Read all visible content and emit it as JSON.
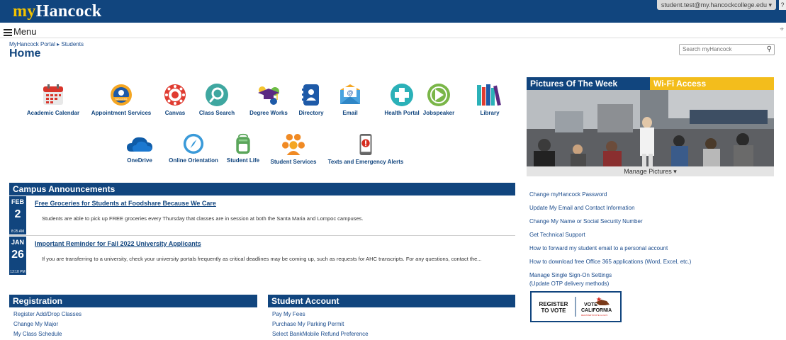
{
  "header": {
    "logo_my": "my",
    "logo_rest": "Hancock",
    "user": "student.test@my.hancockcollege.edu ▾",
    "edge": "?"
  },
  "menu": {
    "label": "Menu"
  },
  "breadcrumb": "MyHancock Portal ▸ Students",
  "page_title": "Home",
  "search": {
    "placeholder": "Search myHancock"
  },
  "apps_row1": [
    {
      "label": "Academic Calendar",
      "icon": "calendar-icon"
    },
    {
      "label": "Appointment Services",
      "icon": "appointment-icon"
    },
    {
      "label": "Canvas",
      "icon": "canvas-icon"
    },
    {
      "label": "Class Search",
      "icon": "search-icon"
    },
    {
      "label": "Degree Works",
      "icon": "graduation-cap-icon"
    },
    {
      "label": "Directory",
      "icon": "directory-icon"
    },
    {
      "label": "Email",
      "icon": "email-icon"
    },
    {
      "label": "Health Portal",
      "icon": "health-icon"
    },
    {
      "label": "Jobspeaker",
      "icon": "jobspeaker-icon"
    },
    {
      "label": "Library",
      "icon": "library-icon"
    }
  ],
  "apps_row2": [
    {
      "label": "OneDrive",
      "icon": "cloud-icon"
    },
    {
      "label": "Online Orientation",
      "icon": "compass-icon"
    },
    {
      "label": "Student Life",
      "icon": "backpack-icon"
    },
    {
      "label": "Student Services",
      "icon": "people-icon"
    },
    {
      "label": "Texts and Emergency Alerts",
      "icon": "alert-phone-icon"
    }
  ],
  "gallery": {
    "tab1": "Pictures Of The Week",
    "tab2": "Wi-Fi Access",
    "manage": "Manage Pictures ▾"
  },
  "quick_links": [
    "Change myHancock Password",
    "Update My Email and Contact Information",
    "Change My Name or Social Security Number",
    "Get Technical Support",
    "How to forward my student email to a personal account",
    "How to download free Office 365 applications (Word, Excel, etc.)"
  ],
  "sso": {
    "line1": "Manage Single Sign-On Settings",
    "line2": "(Update OTP delivery methods)"
  },
  "announcements": {
    "title": "Campus Announcements",
    "items": [
      {
        "month": "FEB",
        "day": "2",
        "time": "8:25 AM",
        "title": "Free Groceries for Students at Foodshare Because We Care",
        "body": "Students are able to pick up FREE groceries every Thursday that classes are in session at both the Santa Maria and Lompoc campuses."
      },
      {
        "month": "JAN",
        "day": "26",
        "time": "12:10 PM",
        "title": "Important Reminder for Fall 2022 University Applicants",
        "body": "If you are transferring to a university, check your university portals frequently as critical deadlines may be coming up, such as requests for AHC transcripts. For any questions, contact the..."
      }
    ]
  },
  "registration": {
    "title": "Registration",
    "links": [
      "Register Add/Drop Classes",
      "Change My Major",
      "My Class Schedule"
    ]
  },
  "student_account": {
    "title": "Student Account",
    "links": [
      "Pay My Fees",
      "Purchase My Parking Permit",
      "Select BankMobile Refund Preference"
    ]
  },
  "vote": {
    "left1": "REGISTER",
    "left2": "TO VOTE",
    "right1": "VOTE",
    "right2": "CALIFORNIA",
    "right3": "REGISTERTOVOTE.CA.GOV"
  },
  "colors": {
    "brand_blue": "#11457e",
    "gold": "#f3bd1c"
  }
}
